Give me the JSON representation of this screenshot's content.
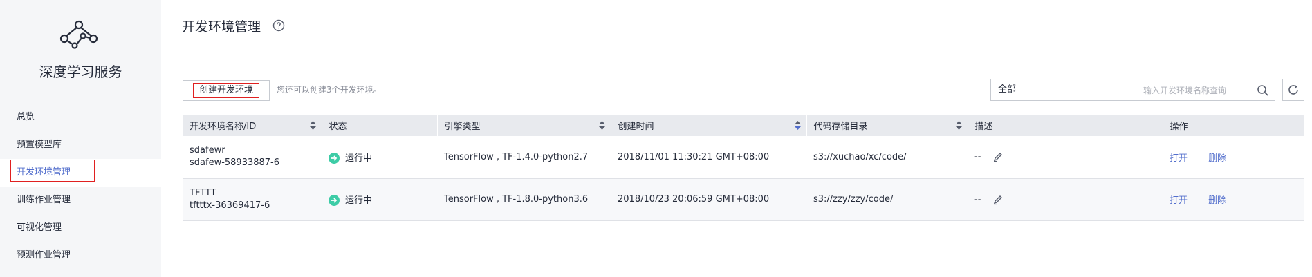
{
  "sidebar": {
    "service_title": "深度学习服务",
    "items": [
      {
        "label": "总览"
      },
      {
        "label": "预置模型库"
      },
      {
        "label": "开发环境管理",
        "active": true
      },
      {
        "label": "训练作业管理"
      },
      {
        "label": "可视化管理"
      },
      {
        "label": "预测作业管理"
      }
    ]
  },
  "header": {
    "title": "开发环境管理"
  },
  "toolbar": {
    "create_label": "创建开发环境",
    "create_hint": "您还可以创建3个开发环境。",
    "filter_value": "全部",
    "search_placeholder": "输入开发环境名称查询"
  },
  "table": {
    "columns": [
      "开发环境名称/ID",
      "状态",
      "引擎类型",
      "创建时间",
      "代码存储目录",
      "描述",
      "操作"
    ],
    "rows": [
      {
        "name": "sdafewr",
        "id": "sdafew-58933887-6",
        "status": "运行中",
        "engine": "TensorFlow , TF-1.4.0-python2.7",
        "created": "2018/11/01 11:30:21 GMT+08:00",
        "code_dir": "s3://xuchao/xc/code/",
        "desc": "--",
        "open": "打开",
        "delete": "删除"
      },
      {
        "name": "TFTTT",
        "id": "tftttx-36369417-6",
        "status": "运行中",
        "engine": "TensorFlow , TF-1.8.0-python3.6",
        "created": "2018/10/23 20:06:59 GMT+08:00",
        "code_dir": "s3://zzy/zzy/code/",
        "desc": "--",
        "open": "打开",
        "delete": "删除"
      }
    ]
  },
  "colors": {
    "accent": "#526ecc",
    "status_running": "#3dcca6",
    "highlight": "#e02020"
  },
  "icons": [
    "logo-icon",
    "help-icon",
    "chevron-down-icon",
    "search-icon",
    "refresh-icon",
    "sort-icon",
    "status-running-icon",
    "edit-icon"
  ]
}
